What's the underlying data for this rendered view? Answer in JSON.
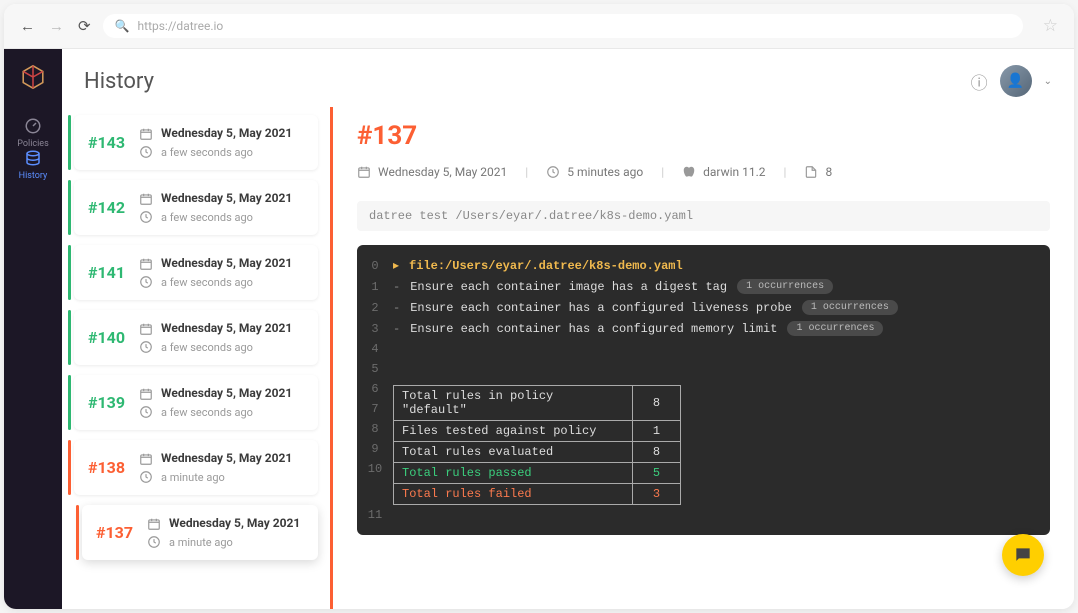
{
  "browser": {
    "url": "https://datree.io"
  },
  "sidebar": {
    "items": [
      {
        "id": "policies",
        "label": "Policies",
        "icon": "gauge"
      },
      {
        "id": "history",
        "label": "History",
        "icon": "db",
        "active": true
      }
    ]
  },
  "page_title": "History",
  "history": [
    {
      "num": "#143",
      "date": "Wednesday 5, May 2021",
      "ago": "a few seconds ago",
      "status": "green"
    },
    {
      "num": "#142",
      "date": "Wednesday 5, May 2021",
      "ago": "a few seconds ago",
      "status": "green"
    },
    {
      "num": "#141",
      "date": "Wednesday 5, May 2021",
      "ago": "a few seconds ago",
      "status": "green"
    },
    {
      "num": "#140",
      "date": "Wednesday 5, May 2021",
      "ago": "a few seconds ago",
      "status": "green"
    },
    {
      "num": "#139",
      "date": "Wednesday 5, May 2021",
      "ago": "a few seconds ago",
      "status": "green"
    },
    {
      "num": "#138",
      "date": "Wednesday 5, May 2021",
      "ago": "a minute ago",
      "status": "orange"
    },
    {
      "num": "#137",
      "date": "Wednesday 5, May 2021",
      "ago": "a minute ago",
      "status": "orange",
      "selected": true
    }
  ],
  "detail": {
    "title": "#137",
    "date": "Wednesday 5, May 2021",
    "ago": "5 minutes ago",
    "platform": "darwin 11.2",
    "file_count": "8",
    "command": "datree test /Users/eyar/.datree/k8s-demo.yaml",
    "file_path": "file:/Users/eyar/.datree/k8s-demo.yaml",
    "rules": [
      {
        "text": "Ensure each container image has a digest tag",
        "occ": "1 occurrences"
      },
      {
        "text": "Ensure each container has a configured liveness probe",
        "occ": "1 occurrences"
      },
      {
        "text": "Ensure each container has a configured memory limit",
        "occ": "1 occurrences"
      }
    ],
    "summary": [
      {
        "label": "Total rules in policy \"default\"",
        "value": "8",
        "class": "c-default"
      },
      {
        "label": "Files tested against policy",
        "value": "1",
        "class": "c-default"
      },
      {
        "label": "Total rules evaluated",
        "value": "8",
        "class": "c-default"
      },
      {
        "label": "Total rules passed",
        "value": "5",
        "class": "c-pass"
      },
      {
        "label": "Total rules failed",
        "value": "3",
        "class": "c-fail"
      }
    ],
    "line_numbers": [
      "0",
      "1",
      "2",
      "3",
      "4",
      "5",
      "6",
      "7",
      "8",
      "9",
      "10",
      "11"
    ]
  }
}
